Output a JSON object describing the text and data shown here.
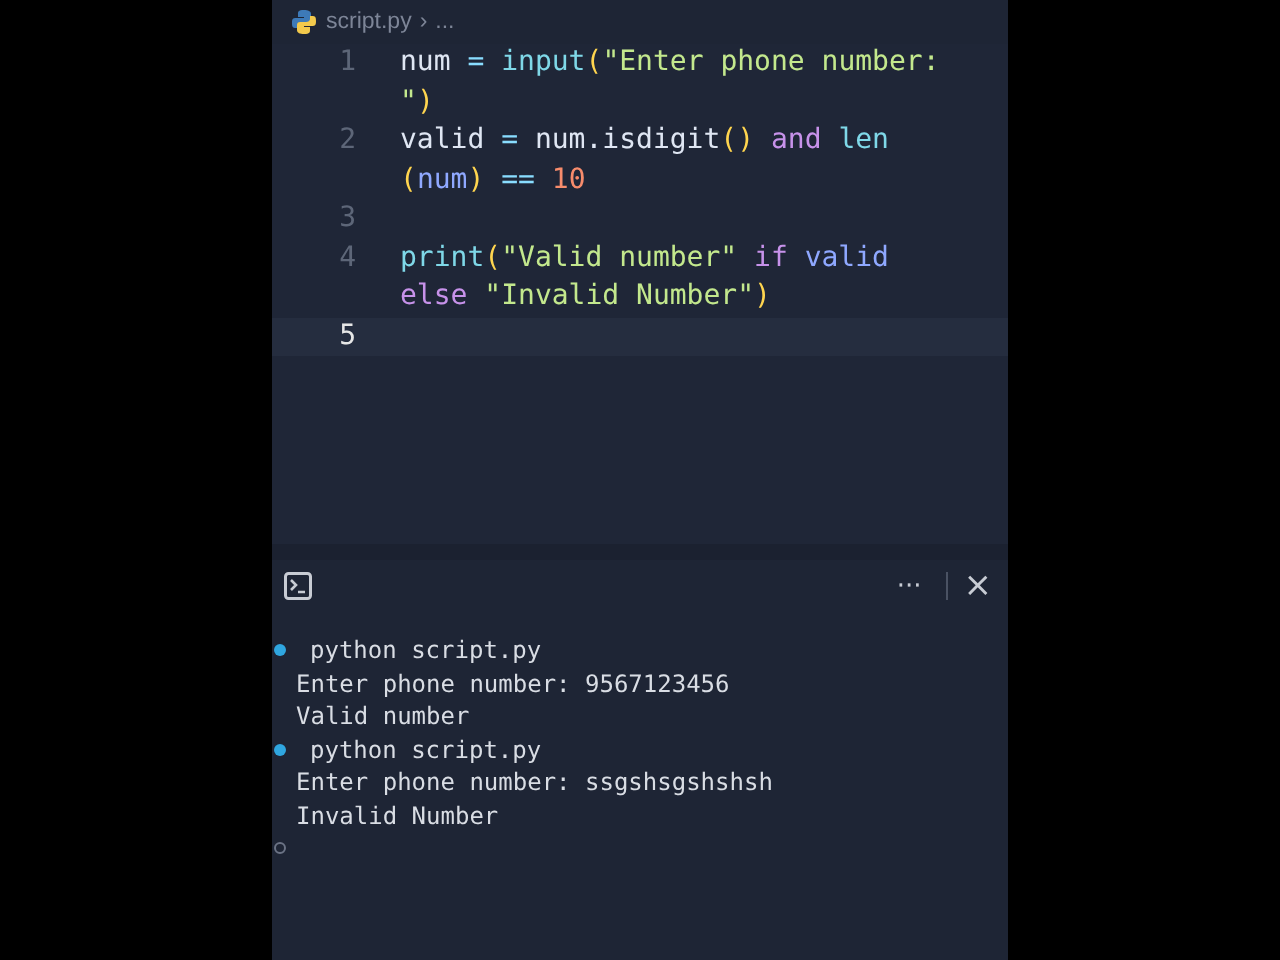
{
  "breadcrumb": {
    "file": "script.py",
    "separator": "›",
    "rest": "..."
  },
  "editor": {
    "rows": [
      {
        "number": "1",
        "active": false,
        "tokens": [
          {
            "kind": "var",
            "text": "num"
          },
          {
            "kind": "op",
            "text": " = "
          },
          {
            "kind": "fn",
            "text": "input"
          },
          {
            "kind": "paren",
            "text": "("
          },
          {
            "kind": "str",
            "text": "\"Enter phone number:"
          }
        ]
      },
      {
        "tokens": [
          {
            "kind": "str",
            "text": "\""
          },
          {
            "kind": "paren",
            "text": ")"
          }
        ]
      },
      {
        "number": "2",
        "active": false,
        "tokens": [
          {
            "kind": "var",
            "text": "valid"
          },
          {
            "kind": "op",
            "text": " = "
          },
          {
            "kind": "var",
            "text": "num.isdigit"
          },
          {
            "kind": "paren",
            "text": "()"
          },
          {
            "kind": "kw",
            "text": " and "
          },
          {
            "kind": "fn",
            "text": "len"
          }
        ]
      },
      {
        "tokens": [
          {
            "kind": "paren",
            "text": "("
          },
          {
            "kind": "ref",
            "text": "num"
          },
          {
            "kind": "paren",
            "text": ")"
          },
          {
            "kind": "op",
            "text": " == "
          },
          {
            "kind": "num",
            "text": "10"
          }
        ]
      },
      {
        "number": "3",
        "active": false
      },
      {
        "number": "4",
        "active": false,
        "tokens": [
          {
            "kind": "fn",
            "text": "print"
          },
          {
            "kind": "paren",
            "text": "("
          },
          {
            "kind": "str",
            "text": "\"Valid number\""
          },
          {
            "kind": "kw",
            "text": " if "
          },
          {
            "kind": "ref",
            "text": "valid"
          }
        ]
      },
      {
        "tokens": [
          {
            "kind": "kw",
            "text": "else "
          },
          {
            "kind": "str",
            "text": "\"Invalid Number\""
          },
          {
            "kind": "paren",
            "text": ")"
          }
        ]
      },
      {
        "number": "5",
        "active": true
      }
    ]
  },
  "panel": {
    "more": "···",
    "close": "×"
  },
  "terminal": [
    {
      "kind": "command",
      "text": "python script.py"
    },
    {
      "kind": "output",
      "text": "Enter phone number: 9567123456"
    },
    {
      "kind": "output",
      "text": "Valid number"
    },
    {
      "kind": "command",
      "text": "python script.py"
    },
    {
      "kind": "output",
      "text": "Enter phone number: ssgshsgshshsh"
    },
    {
      "kind": "output",
      "text": "Invalid Number"
    },
    {
      "kind": "idle"
    }
  ]
}
